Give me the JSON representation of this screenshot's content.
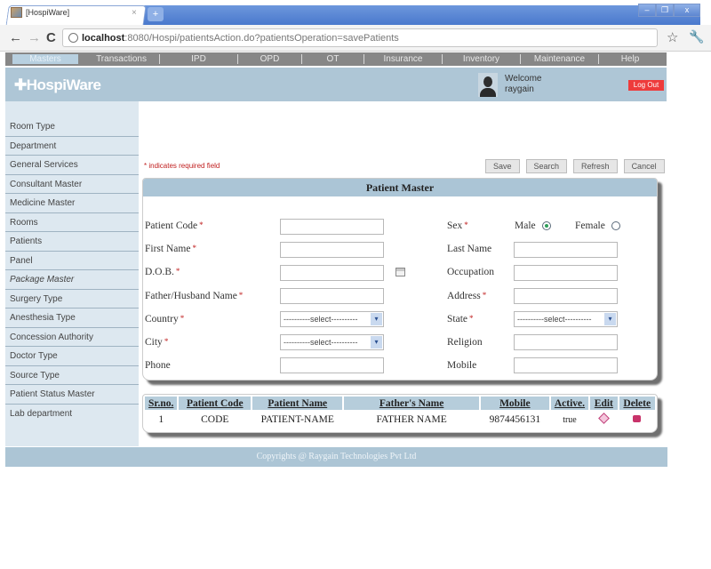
{
  "browser": {
    "tab_title": "[HospiWare]",
    "tab_close": "×",
    "new_tab": "+",
    "window_buttons": {
      "minimize": "–",
      "restore": "❐",
      "close": "x"
    },
    "url_host": "localhost",
    "url_rest": ":8080/Hospi/patientsAction.do?patientsOperation=savePatients",
    "back": "←",
    "forward": "→",
    "reload": "C",
    "bookmark": "☆",
    "wrench": "🔧"
  },
  "menu": {
    "items": [
      {
        "label": "Masters",
        "active": true
      },
      {
        "label": "Transactions"
      },
      {
        "label": "IPD"
      },
      {
        "label": "OPD"
      },
      {
        "label": "OT"
      },
      {
        "label": "Insurance"
      },
      {
        "label": "Inventory"
      },
      {
        "label": "Maintenance"
      },
      {
        "label": "Help"
      }
    ]
  },
  "header": {
    "logo": "✚HospiWare",
    "welcome": "Welcome",
    "username": "raygain",
    "logout": "Log Out"
  },
  "sidebar": {
    "items": [
      "Room Type",
      "Department",
      "General Services",
      "Consultant Master",
      "Medicine Master",
      "Rooms",
      "Patients",
      "Panel",
      "Package Master",
      "Surgery Type",
      "Anesthesia Type",
      "Concession Authority",
      "Doctor Type",
      "Source Type",
      "Patient Status Master",
      "Lab department"
    ]
  },
  "main": {
    "required_note": "* indicates required field",
    "buttons": {
      "save": "Save",
      "search": "Search",
      "refresh": "Refresh",
      "cancel": "Cancel"
    },
    "panel_title": "Patient Master",
    "form": {
      "patient_code": {
        "label": "Patient Code",
        "value": ""
      },
      "first_name": {
        "label": "First Name",
        "value": ""
      },
      "dob": {
        "label": "D.O.B.",
        "value": ""
      },
      "father_name": {
        "label": "Father/Husband Name",
        "value": ""
      },
      "country": {
        "label": "Country",
        "value": "----------select----------"
      },
      "city": {
        "label": "City",
        "value": "----------select----------"
      },
      "phone": {
        "label": "Phone",
        "value": ""
      },
      "sex": {
        "label": "Sex",
        "male": "Male",
        "female": "Female",
        "selected": "Male"
      },
      "last_name": {
        "label": "Last Name",
        "value": ""
      },
      "occupation": {
        "label": "Occupation",
        "value": ""
      },
      "address": {
        "label": "Address",
        "value": ""
      },
      "state": {
        "label": "State",
        "value": "----------select----------"
      },
      "religion": {
        "label": "Religion",
        "value": ""
      },
      "mobile": {
        "label": "Mobile",
        "value": ""
      },
      "required_mark": "*",
      "dropdown_arrow": "▾"
    },
    "table": {
      "headers": [
        "Sr.no.",
        "Patient Code",
        "Patient Name",
        "Father's Name",
        "Mobile",
        "Active.",
        "Edit",
        "Delete"
      ],
      "rows": [
        {
          "srno": "1",
          "code": "CODE",
          "name": "PATIENT-NAME",
          "father": "FATHER NAME",
          "mobile": "9874456131",
          "active": "true"
        }
      ]
    }
  },
  "footer": {
    "text": "Copyrights @ Raygain Technologies Pvt Ltd"
  }
}
